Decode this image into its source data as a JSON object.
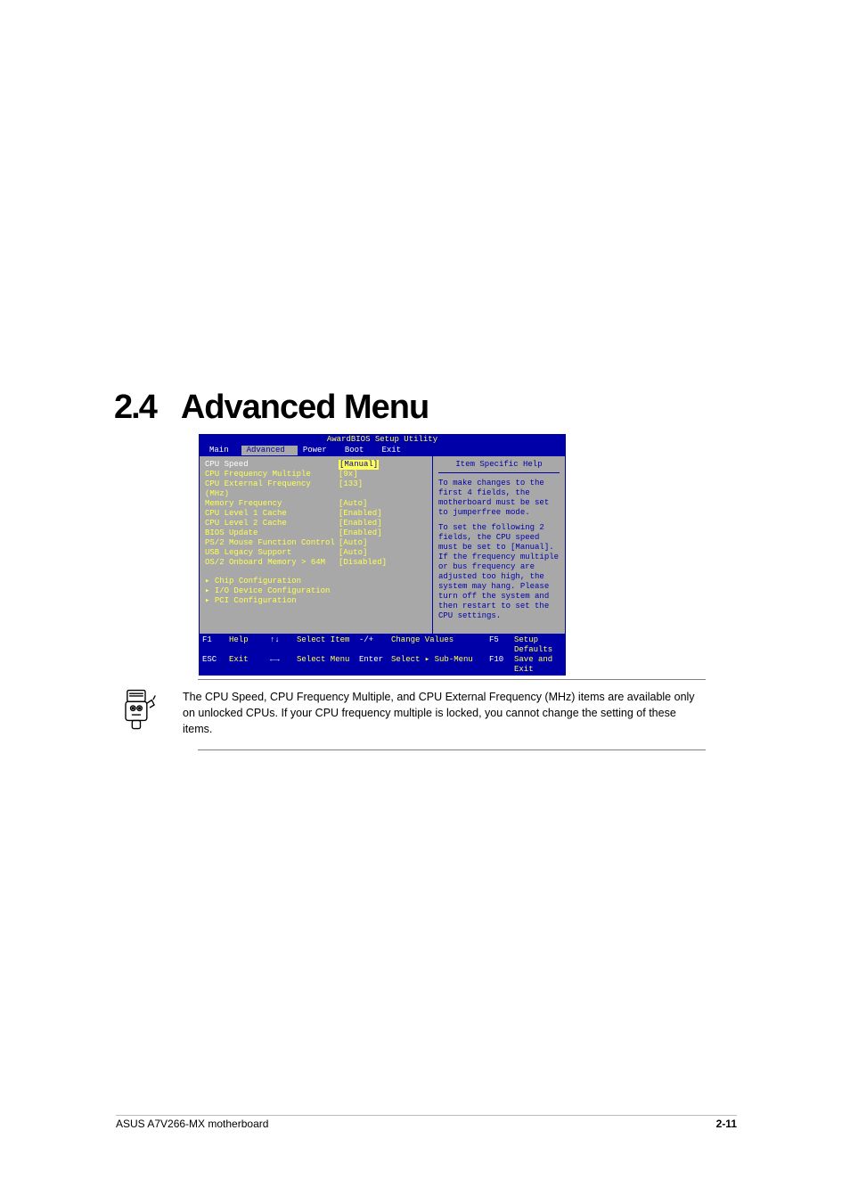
{
  "heading": {
    "number": "2.4",
    "title": "Advanced Menu"
  },
  "bios": {
    "title": "AwardBIOS Setup Utility",
    "tabs": [
      "Main",
      "Advanced",
      "Power",
      "Boot",
      "Exit"
    ],
    "active_tab": "Advanced",
    "settings": [
      {
        "label": "CPU Speed",
        "value": "[Manual]",
        "highlight": true
      },
      {
        "label": "CPU Frequency Multiple",
        "value": "[9x]"
      },
      {
        "label": "CPU External Frequency (MHz)",
        "value": "[133]"
      },
      {
        "label": "Memory Frequency",
        "value": "[Auto]"
      },
      {
        "label": "CPU Level 1 Cache",
        "value": "[Enabled]"
      },
      {
        "label": "CPU Level 2 Cache",
        "value": "[Enabled]"
      },
      {
        "label": "BIOS Update",
        "value": "[Enabled]"
      },
      {
        "label": "PS/2 Mouse Function Control",
        "value": "[Auto]"
      },
      {
        "label": "USB Legacy Support",
        "value": "[Auto]"
      },
      {
        "label": "OS/2 Onboard Memory > 64M",
        "value": "[Disabled]"
      }
    ],
    "submenus": [
      "Chip Configuration",
      "I/O Device Configuration",
      "PCI Configuration"
    ],
    "help": {
      "title": "Item Specific Help",
      "para1": "To make changes to the first 4 fields, the motherboard must be set to jumperfree mode.",
      "para2": "To set the following 2 fields, the CPU speed must be set to [Manual]. If the frequency multiple or bus frequency are adjusted too high, the system may hang. Please turn off the system and then restart to set the CPU settings."
    },
    "footer": {
      "f1": "F1",
      "help": "Help",
      "updown": "↑↓",
      "select_item": "Select Item",
      "pm": "-/+",
      "change_values": "Change Values",
      "f5": "F5",
      "setup_defaults": "Setup Defaults",
      "esc": "ESC",
      "exit": "Exit",
      "lr": "←→",
      "select_menu": "Select Menu",
      "enter": "Enter",
      "select_sub": "Select ▸ Sub-Menu",
      "f10": "F10",
      "save_exit": "Save and Exit"
    }
  },
  "note": {
    "text": "The CPU Speed, CPU Frequency Multiple, and CPU External Frequency (MHz) items are available only on unlocked CPUs. If your CPU frequency multiple is locked, you cannot change the setting of these items."
  },
  "footer": {
    "left": "ASUS A7V266-MX motherboard",
    "right_bold": "2-11"
  }
}
